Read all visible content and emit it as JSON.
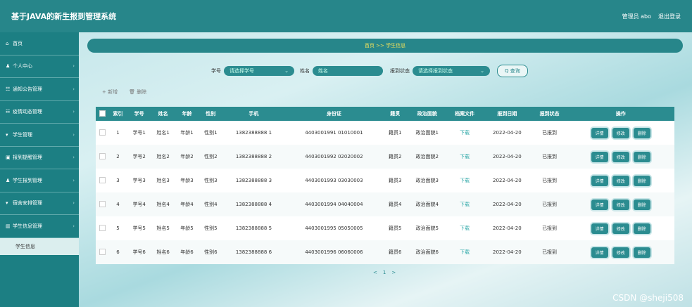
{
  "app": {
    "title": "基于JAVA的新生报到管理系统",
    "admin": "管理员 abo",
    "logout": "退出登录"
  },
  "sidebar": {
    "items": [
      {
        "icon": "⌂",
        "label": "首页"
      },
      {
        "icon": "♟",
        "label": "个人中心"
      },
      {
        "icon": "☷",
        "label": "通知公告管理"
      },
      {
        "icon": "☷",
        "label": "疫情动态管理"
      },
      {
        "icon": "▾",
        "label": "学生管理"
      },
      {
        "icon": "▣",
        "label": "报到提醒管理"
      },
      {
        "icon": "♟",
        "label": "学生报到管理"
      },
      {
        "icon": "▾",
        "label": "宿舍安排管理"
      },
      {
        "icon": "▥",
        "label": "学生信息管理"
      }
    ],
    "sub": "学生信息"
  },
  "breadcrumb": "首页 >> 学生信息",
  "search": {
    "xh_label": "学号",
    "xh_ph": "请选择学号",
    "xm_label": "姓名",
    "xm_ph": "姓名",
    "zt_label": "报到状态",
    "zt_ph": "请选择报到状态",
    "query": "Q 查询"
  },
  "actions": {
    "add": "+ 新增",
    "del": "🗑 删除"
  },
  "table": {
    "headers": [
      "索引",
      "学号",
      "姓名",
      "年龄",
      "性别",
      "手机",
      "身份证",
      "籍贯",
      "政治面貌",
      "档案文件",
      "报到日期",
      "报到状态",
      "操作"
    ],
    "rows": [
      [
        "1",
        "学号1",
        "姓名1",
        "年龄1",
        "性别1",
        "1382388888 1",
        "4403001991 01010001",
        "籍贯1",
        "政治面貌1",
        "下载",
        "2022-04-20",
        "已报到"
      ],
      [
        "2",
        "学号2",
        "姓名2",
        "年龄2",
        "性别2",
        "1382388888 2",
        "4403001992 02020002",
        "籍贯2",
        "政治面貌2",
        "下载",
        "2022-04-20",
        "已报到"
      ],
      [
        "3",
        "学号3",
        "姓名3",
        "年龄3",
        "性别3",
        "1382388888 3",
        "4403001993 03030003",
        "籍贯3",
        "政治面貌3",
        "下载",
        "2022-04-20",
        "已报到"
      ],
      [
        "4",
        "学号4",
        "姓名4",
        "年龄4",
        "性别4",
        "1382388888 4",
        "4403001994 04040004",
        "籍贯4",
        "政治面貌4",
        "下载",
        "2022-04-20",
        "已报到"
      ],
      [
        "5",
        "学号5",
        "姓名5",
        "年龄5",
        "性别5",
        "1382388888 5",
        "4403001995 05050005",
        "籍贯5",
        "政治面貌5",
        "下载",
        "2022-04-20",
        "已报到"
      ],
      [
        "6",
        "学号6",
        "姓名6",
        "年龄6",
        "性别6",
        "1382388888 6",
        "4403001996 06060006",
        "籍贯6",
        "政治面貌6",
        "下载",
        "2022-04-20",
        "已报到"
      ]
    ],
    "ops": [
      "详情",
      "修改",
      "删除"
    ]
  },
  "pager": {
    "prev": "<",
    "page": "1",
    "next": ">"
  },
  "watermark": "CSDN @sheji508"
}
